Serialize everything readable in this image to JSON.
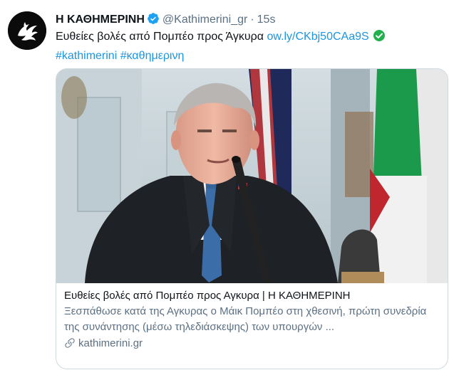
{
  "tweet": {
    "author_name": "Η ΚΑΘΗΜΕΡΙΝΗ",
    "handle": "@Kathimerini_gr",
    "separator": "·",
    "time": "15s",
    "text_main": "Ευθείες βολές από Πομπέο προς Άγκυρα",
    "link_text": "ow.ly/CKbj50CAa9S",
    "hashtag_1": "#kathimerini",
    "hashtag_2": "#καθημερινη",
    "colors": {
      "link": "#1b95e0",
      "verified": "#1da1f2",
      "secondary": "#5b7083",
      "check_badge": "#21b04b"
    },
    "icons": [
      "verified-badge-icon",
      "green-check-icon",
      "link-icon"
    ]
  },
  "card": {
    "title": "Ευθείες βολές από Πομπέο προς Αγκυρα | Η ΚΑΘΗΜΕΡΙΝΗ",
    "description": "Ξεσπάθωσε κατά της Αγκυρας ο Μάικ Πομπέο στη χθεσινή, πρώτη συνεδρία της συνάντησης (μέσω τηλεδιάσκεψης) των υπουργών ...",
    "domain": "kathimerini.gr"
  }
}
